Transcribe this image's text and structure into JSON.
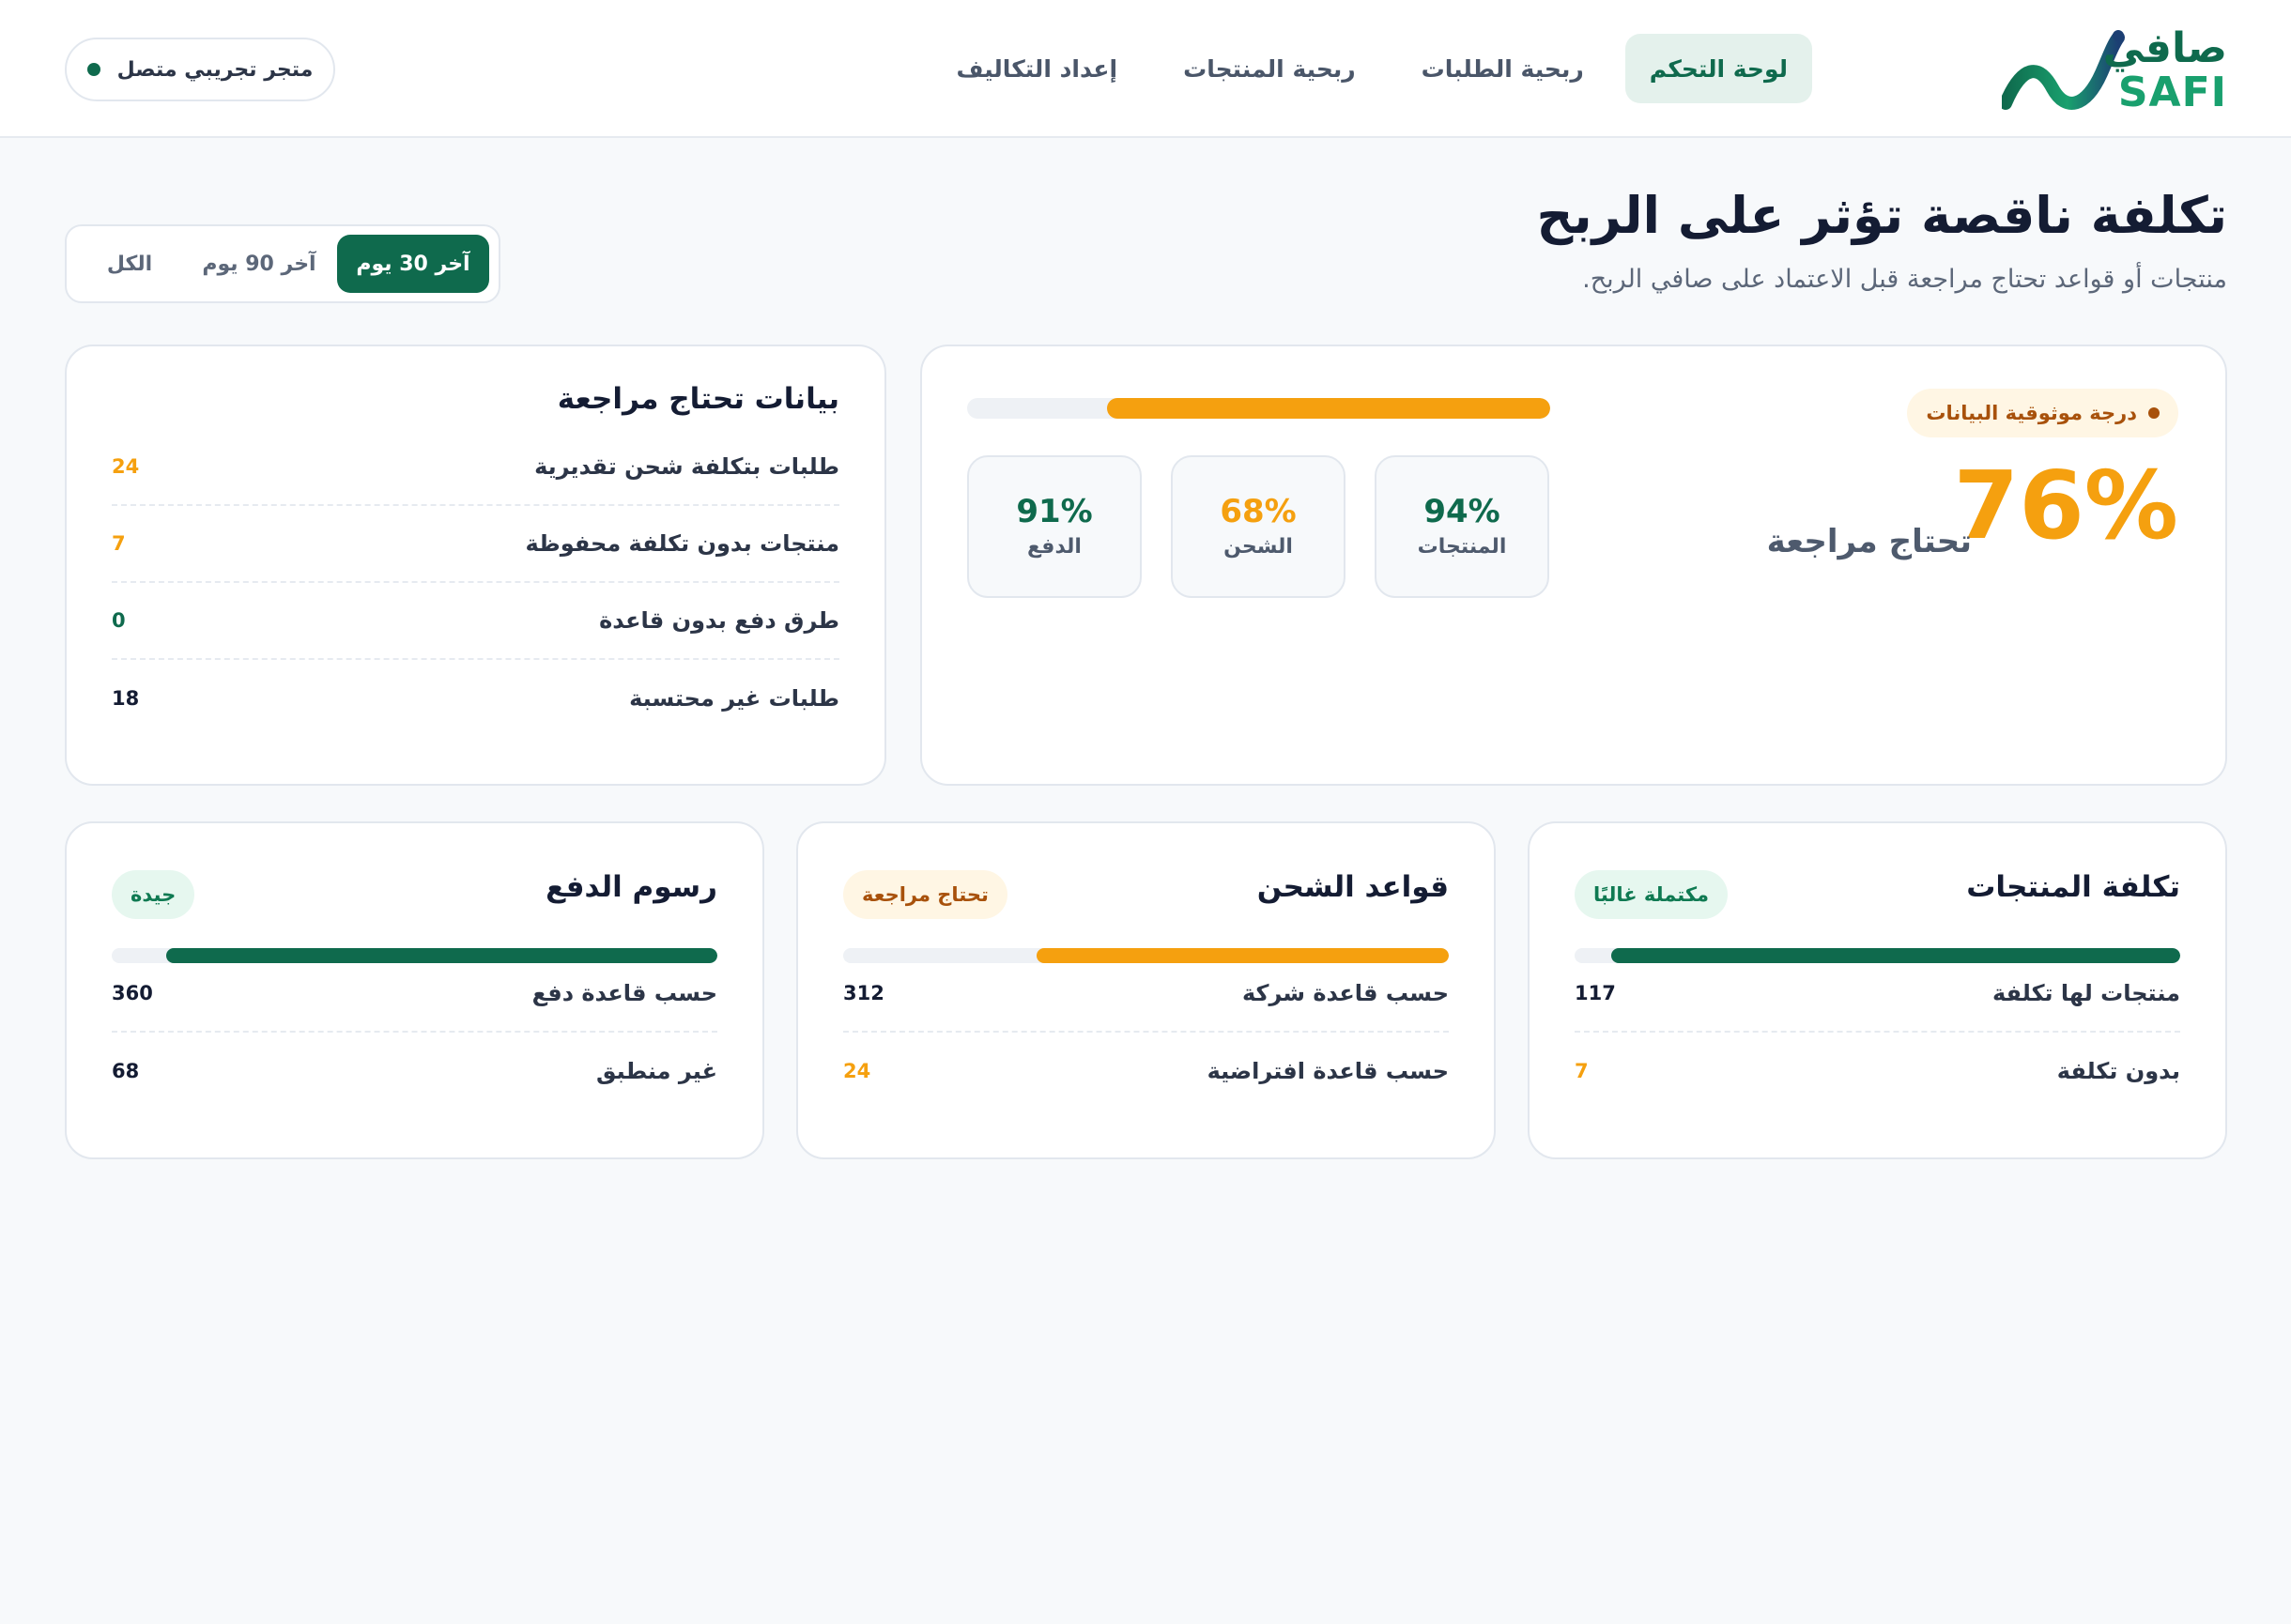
{
  "header": {
    "logo_ar": "صافي",
    "logo_en": "SAFI",
    "nav": [
      "لوحة التحكم",
      "ربحية الطلبات",
      "ربحية المنتجات",
      "إعداد التكاليف"
    ],
    "store_status": "متجر تجريبي متصل"
  },
  "page": {
    "title": "تكلفة ناقصة تؤثر على الربح",
    "subtitle": "منتجات أو قواعد تحتاج مراجعة قبل الاعتماد على صافي الربح.",
    "ranges": [
      "آخر 30 يوم",
      "آخر 90 يوم",
      "الكل"
    ],
    "active_range": "آخر 30 يوم"
  },
  "reliability": {
    "badge": "درجة موثوقية البيانات",
    "percent": "76%",
    "label": "تحتاج مراجعة",
    "progress": 0.76,
    "metrics": [
      {
        "value": "94%",
        "label": "المنتجات",
        "color": "#0f6a4d"
      },
      {
        "value": "68%",
        "label": "الشحن",
        "color": "#f5a00f"
      },
      {
        "value": "91%",
        "label": "الدفع",
        "color": "#0f6a4d"
      }
    ]
  },
  "review": {
    "title": "بيانات تحتاج مراجعة",
    "items": [
      {
        "label": "طلبات بتكلفة شحن تقديرية",
        "value": "24",
        "color": "#f5a00f"
      },
      {
        "label": "منتجات بدون تكلفة محفوظة",
        "value": "7",
        "color": "#f5a00f"
      },
      {
        "label": "طرق دفع بدون قاعدة",
        "value": "0",
        "color": "#0f6a4d"
      },
      {
        "label": "طلبات غير محتسبة",
        "value": "18",
        "color": "#141c33"
      }
    ]
  },
  "cards": [
    {
      "title": "تكلفة المنتجات",
      "badge": "مكتملة غالبًا",
      "badge_tone": "ok",
      "progress": 0.94,
      "bar_color": "#0f6a4d",
      "rows": [
        {
          "label": "منتجات لها تكلفة",
          "value": "117",
          "color": "#141c33"
        },
        {
          "label": "بدون تكلفة",
          "value": "7",
          "color": "#f5a00f"
        }
      ]
    },
    {
      "title": "قواعد الشحن",
      "badge": "تحتاج مراجعة",
      "badge_tone": "warn",
      "progress": 0.68,
      "bar_color": "#f5a00f",
      "rows": [
        {
          "label": "حسب قاعدة شركة",
          "value": "312",
          "color": "#141c33"
        },
        {
          "label": "حسب قاعدة افتراضية",
          "value": "24",
          "color": "#f5a00f"
        }
      ]
    },
    {
      "title": "رسوم الدفع",
      "badge": "جيدة",
      "badge_tone": "ok",
      "progress": 0.91,
      "bar_color": "#0f6a4d",
      "rows": [
        {
          "label": "حسب قاعدة دفع",
          "value": "360",
          "color": "#141c33"
        },
        {
          "label": "غير منطبق",
          "value": "68",
          "color": "#141c33"
        }
      ]
    }
  ]
}
